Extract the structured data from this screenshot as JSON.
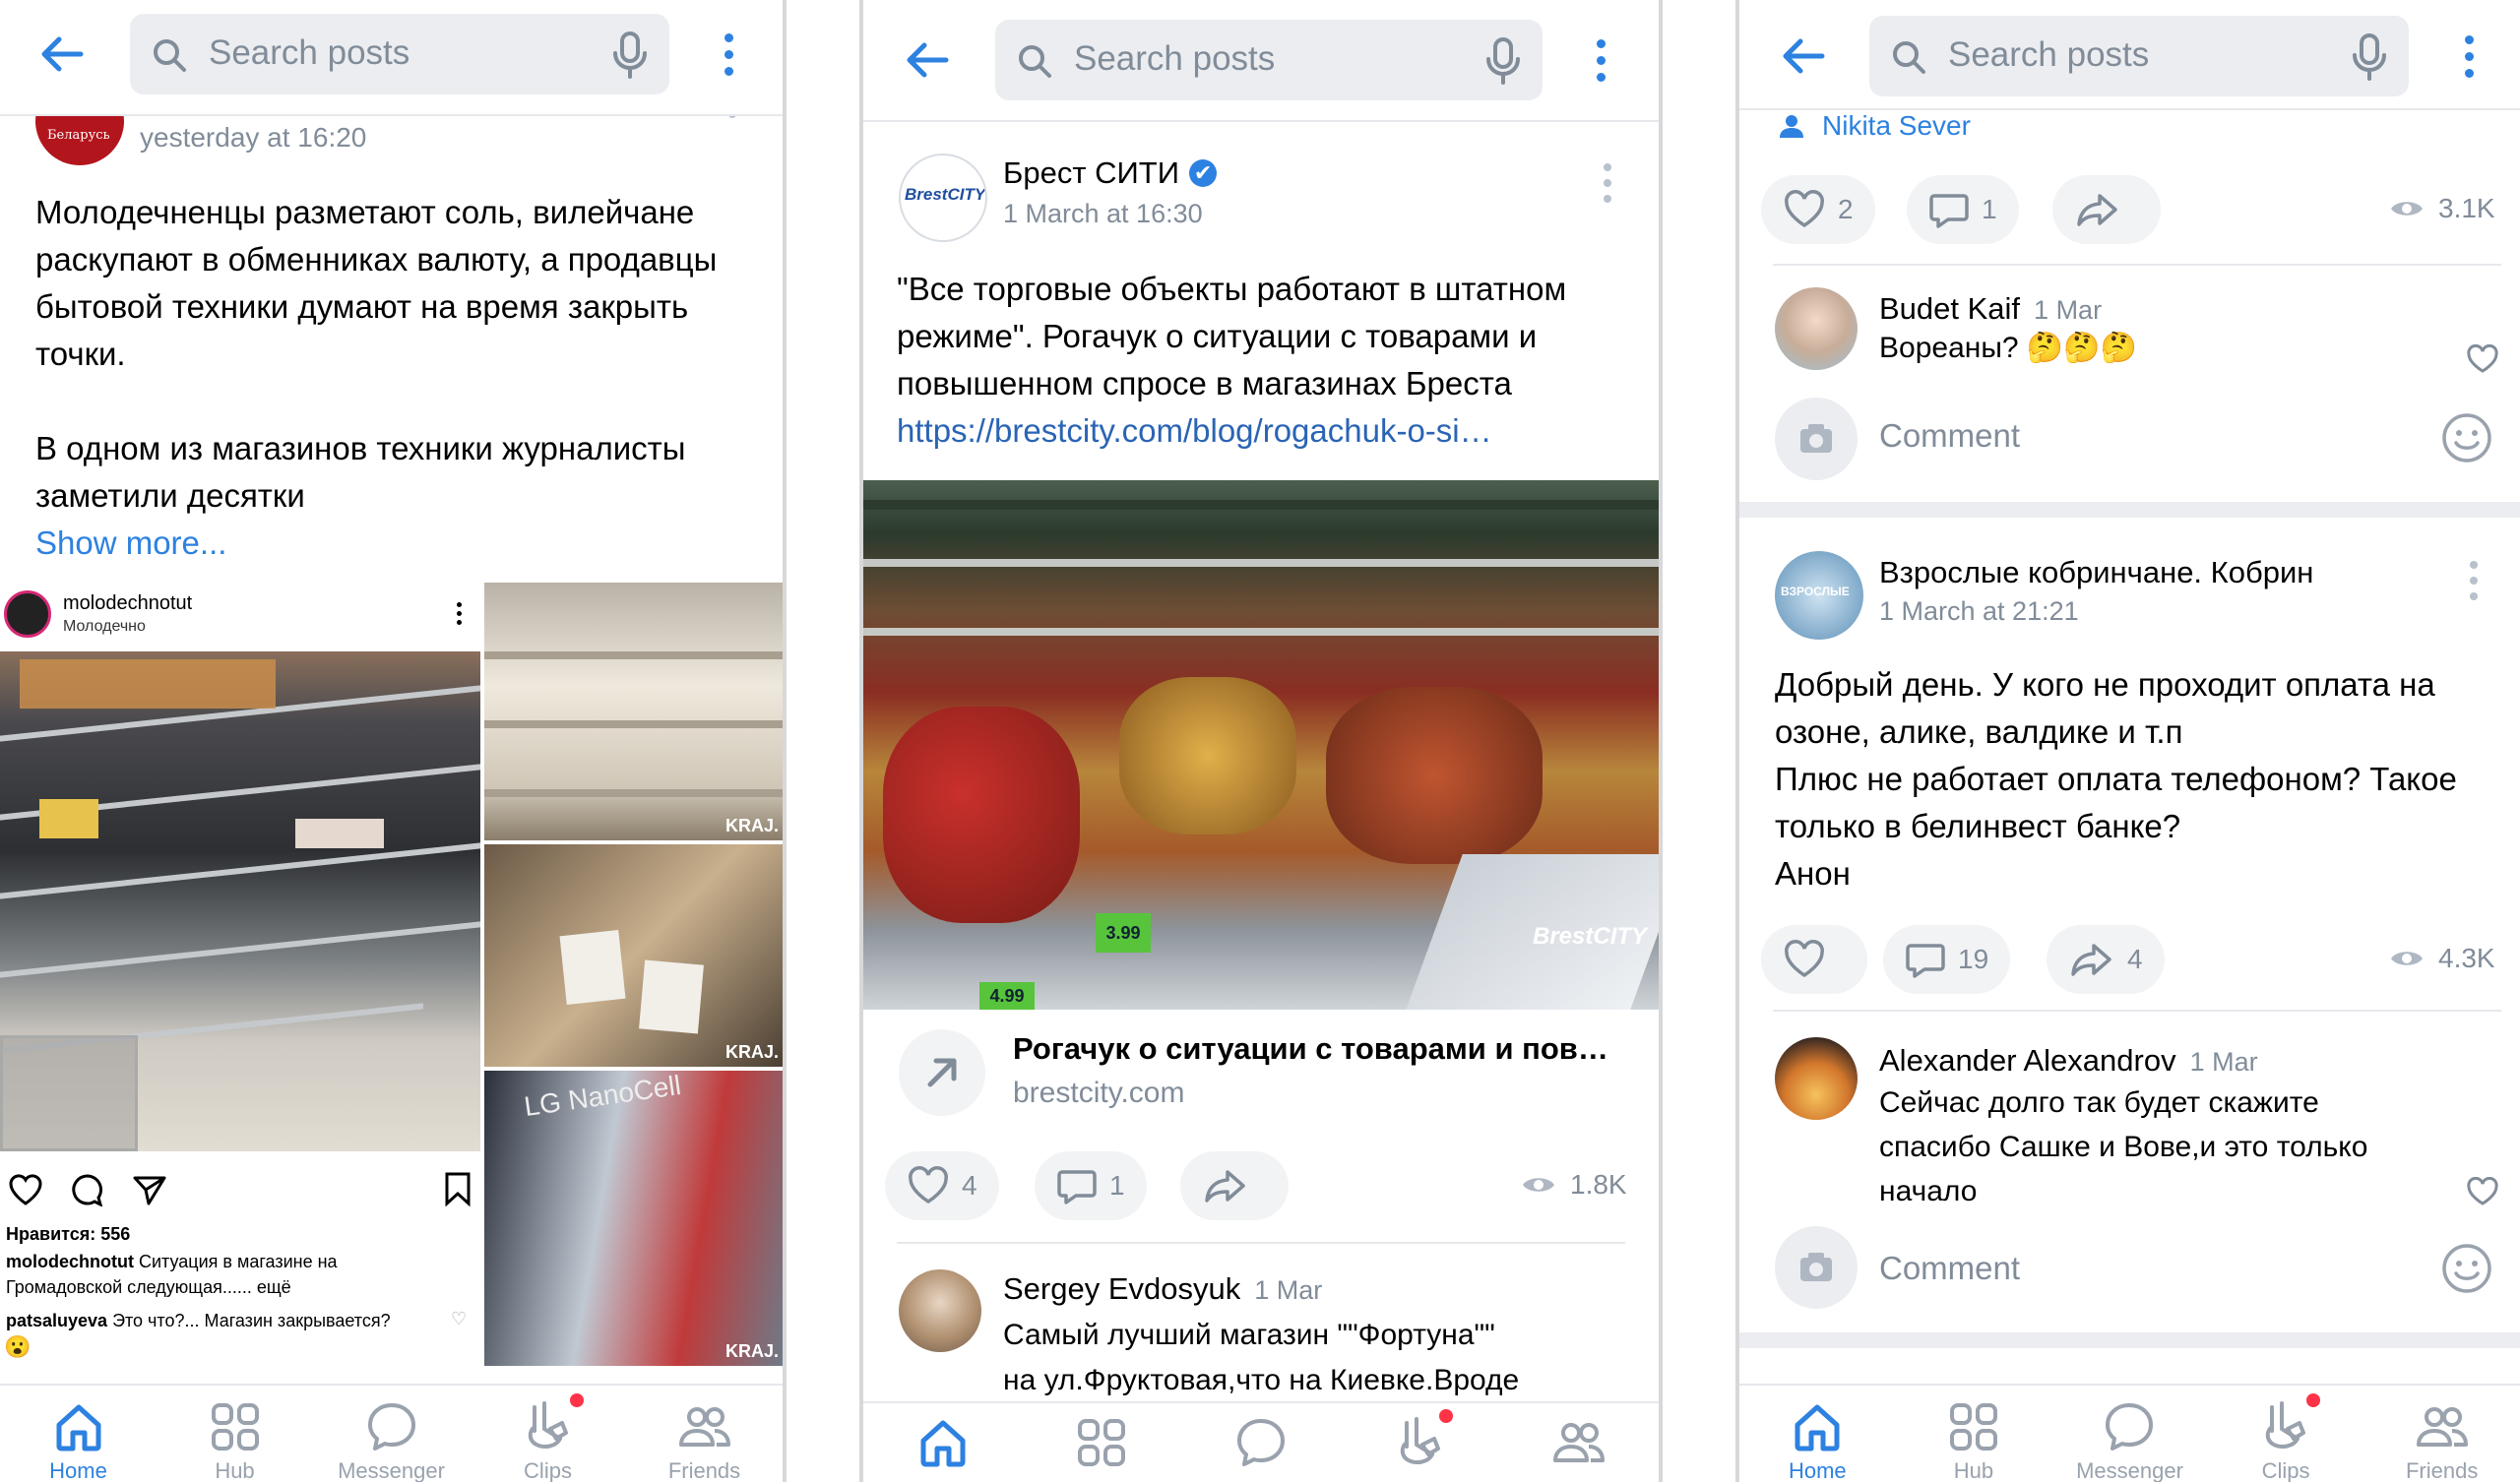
{
  "colors": {
    "accent": "#2d81e0",
    "link": "#2a64b4",
    "muted": "#818c99",
    "badge": "#ff3347"
  },
  "common": {
    "search_placeholder": "Search posts",
    "nav": [
      "Home",
      "Hub",
      "Messenger",
      "Clips",
      "Friends"
    ]
  },
  "p1": {
    "date": "yesterday at 16:20",
    "logo_text": "Беларусь",
    "text_lines": [
      "Молодечненцы разметают соль, вилейчане",
      "раскупают в обменниках валюту, а продавцы",
      "бытовой техники думают на время закрыть",
      "точки.",
      "",
      "В одном из магазинов техники  журналисты",
      "заметили десятки"
    ],
    "show_more": "Show more...",
    "insta": {
      "account": "molodechnotut",
      "location": "Молодечно",
      "likes": "Нравится: 556",
      "caption_user": "molodechnotut",
      "caption_text": " Ситуация в магазине на",
      "caption_text2": "Громадовской следующая...... ещё",
      "comment_user": "patsaluyeva",
      "comment_text": " Это что?... Магазин закрывается?",
      "emoji": "😮",
      "watermark": "KRAJ.",
      "sign": "LG NanoCell"
    }
  },
  "p2": {
    "author": "Брест СИТИ",
    "verified": "✔",
    "date": "1 March at 16:30",
    "avatar_text": "BrestCITY",
    "text_lines": [
      "\"Все торговые объекты работают в штатном",
      "режиме\". Рогачук о ситуации с товарами и",
      "повышенном спросе в магазинах Бреста"
    ],
    "url": "https://brestcity.com/blog/rogachuk-o-si…",
    "photo_watermark": "BrestCITY",
    "price1": "3.99",
    "price2": "4.99",
    "link_title": "Рогачук о ситуации с товарами и пов…",
    "link_domain": "brestcity.com",
    "likes": "4",
    "comments": "1",
    "views": "1.8K",
    "comment": {
      "name": "Sergey Evdosyuk",
      "date": "1 Mar",
      "line1": "Самый лучший магазин  \"\"Фортуна\"\"",
      "line2": "на ул.Фруктовая,что на Киевке.Вроде"
    }
  },
  "p3": {
    "top_author": "Nikita Sever",
    "post1": {
      "likes": "2",
      "comments": "1",
      "views": "3.1K"
    },
    "comment1": {
      "name": "Budet Kaif",
      "date": "1 Mar",
      "text": "Ворeаны? 🤔🤔🤔"
    },
    "comment_placeholder": "Comment",
    "post2": {
      "author": "Взрослые кобринчане. Кобрин",
      "date": "1 March at 21:21",
      "avatar_text": "ВЗРОСЛЫЕ",
      "text_lines": [
        "Добрый день. У кого не проходит оплата на",
        "озоне, алике, валдике и т.п",
        "Плюс не работает оплата телефоном? Такое",
        "только в белинвест банке?",
        "Анон"
      ],
      "likes": "",
      "comments": "19",
      "shares": "4",
      "views": "4.3K"
    },
    "comment2": {
      "name": "Alexander Alexandrov",
      "date": "1 Mar",
      "lines": [
        "Сейчас долго так будет скажите",
        "спасибо Сашке и Вове,и это только",
        "начало"
      ]
    }
  }
}
